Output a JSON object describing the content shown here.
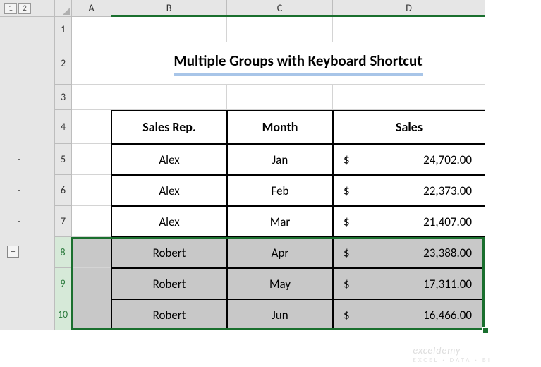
{
  "outline": {
    "levels": [
      "1",
      "2"
    ],
    "collapse_symbol": "−"
  },
  "columns": [
    "A",
    "B",
    "C",
    "D"
  ],
  "rows": [
    "1",
    "2",
    "3",
    "4",
    "5",
    "6",
    "7",
    "8",
    "9",
    "10"
  ],
  "title": "Multiple Groups with Keyboard Shortcut",
  "headers": {
    "rep": "Sales Rep.",
    "month": "Month",
    "sales": "Sales"
  },
  "currency": "$",
  "data": [
    {
      "rep": "Alex",
      "month": "Jan",
      "sales": "24,702.00"
    },
    {
      "rep": "Alex",
      "month": "Feb",
      "sales": "22,373.00"
    },
    {
      "rep": "Alex",
      "month": "Mar",
      "sales": "21,407.00"
    },
    {
      "rep": "Robert",
      "month": "Apr",
      "sales": "23,388.00"
    },
    {
      "rep": "Robert",
      "month": "May",
      "sales": "17,311.00"
    },
    {
      "rep": "Robert",
      "month": "Jun",
      "sales": "16,466.00"
    }
  ],
  "watermark": {
    "main": "exceldemy",
    "sub": "EXCEL · DATA · BI"
  },
  "chart_data": {
    "type": "table",
    "title": "Multiple Groups with Keyboard Shortcut",
    "columns": [
      "Sales Rep.",
      "Month",
      "Sales"
    ],
    "rows": [
      [
        "Alex",
        "Jan",
        24702.0
      ],
      [
        "Alex",
        "Feb",
        22373.0
      ],
      [
        "Alex",
        "Mar",
        21407.0
      ],
      [
        "Robert",
        "Apr",
        23388.0
      ],
      [
        "Robert",
        "May",
        17311.0
      ],
      [
        "Robert",
        "Jun",
        16466.0
      ]
    ]
  }
}
